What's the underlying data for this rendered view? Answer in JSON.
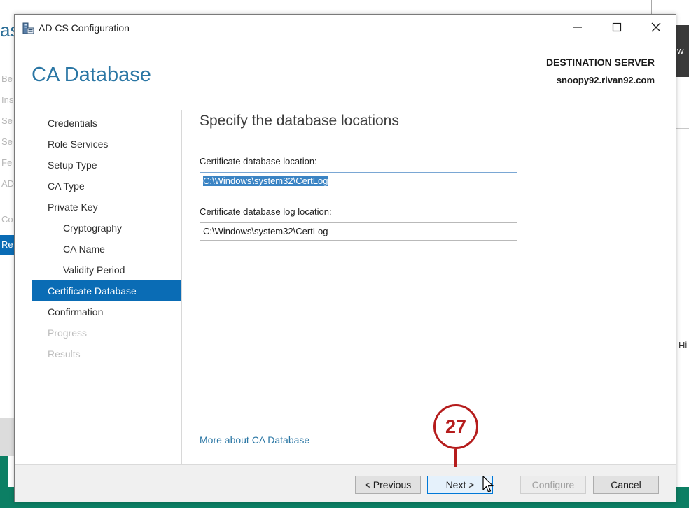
{
  "background": {
    "left_title": "ast",
    "left_items": [
      "Be",
      "Ins",
      "Se",
      "Se",
      "Fe",
      "AD"
    ],
    "left_co": "Co",
    "left_selected": "Re",
    "right_dark": "w",
    "right_hi": "Hi"
  },
  "window": {
    "title": "AD CS Configuration",
    "icon": "server-config-icon"
  },
  "header": {
    "title": "CA Database",
    "destination_label": "DESTINATION SERVER",
    "destination_server": "snoopy92.rivan92.com"
  },
  "nav": {
    "items": [
      {
        "label": "Credentials",
        "state": "normal",
        "sub": false
      },
      {
        "label": "Role Services",
        "state": "normal",
        "sub": false
      },
      {
        "label": "Setup Type",
        "state": "normal",
        "sub": false
      },
      {
        "label": "CA Type",
        "state": "normal",
        "sub": false
      },
      {
        "label": "Private Key",
        "state": "normal",
        "sub": false
      },
      {
        "label": "Cryptography",
        "state": "normal",
        "sub": true
      },
      {
        "label": "CA Name",
        "state": "normal",
        "sub": true
      },
      {
        "label": "Validity Period",
        "state": "normal",
        "sub": true
      },
      {
        "label": "Certificate Database",
        "state": "active",
        "sub": false
      },
      {
        "label": "Confirmation",
        "state": "normal",
        "sub": false
      },
      {
        "label": "Progress",
        "state": "disabled",
        "sub": false
      },
      {
        "label": "Results",
        "state": "disabled",
        "sub": false
      }
    ]
  },
  "main": {
    "section_title": "Specify the database locations",
    "db_location_label": "Certificate database location:",
    "db_location_value": "C:\\Windows\\system32\\CertLog",
    "db_log_label": "Certificate database log location:",
    "db_log_value": "C:\\Windows\\system32\\CertLog",
    "more_link": "More about CA Database"
  },
  "footer": {
    "previous": "< Previous",
    "next": "Next >",
    "configure": "Configure",
    "cancel": "Cancel"
  },
  "callout": {
    "number": "27"
  },
  "colors": {
    "accent": "#0a6cb5",
    "title_blue": "#2a76a4",
    "callout_red": "#b51c1c",
    "background_green": "#0c7f64"
  }
}
